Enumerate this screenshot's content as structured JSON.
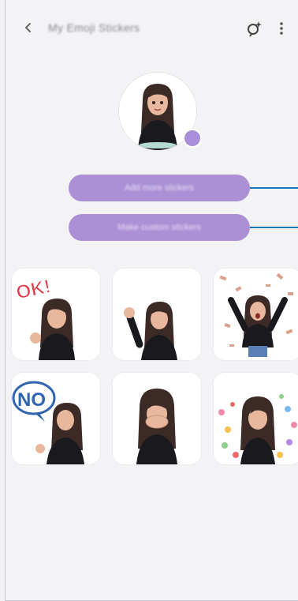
{
  "header": {
    "back_icon": "back-arrow-icon",
    "title": "My Emoji Stickers",
    "sync_icon": "sparkle-emoji-icon",
    "menu_icon": "more-options-icon"
  },
  "profile": {
    "avatar_icon": "ar-emoji-avatar",
    "badge_icon": "edit-badge-icon"
  },
  "buttons": [
    {
      "label": "Add more stickers"
    },
    {
      "label": "Make custom stickers"
    }
  ],
  "stickers": [
    {
      "name": "ok-sticker",
      "text": "OK!"
    },
    {
      "name": "wave-sticker",
      "text": ""
    },
    {
      "name": "celebrate-sticker",
      "text": ""
    },
    {
      "name": "no-sticker",
      "text": "NO"
    },
    {
      "name": "facepalm-sticker",
      "text": ""
    },
    {
      "name": "confetti-sticker",
      "text": ""
    }
  ],
  "colors": {
    "accent": "#ab90d6",
    "callout_line": "#1877b8",
    "background": "#f3f3f5"
  }
}
